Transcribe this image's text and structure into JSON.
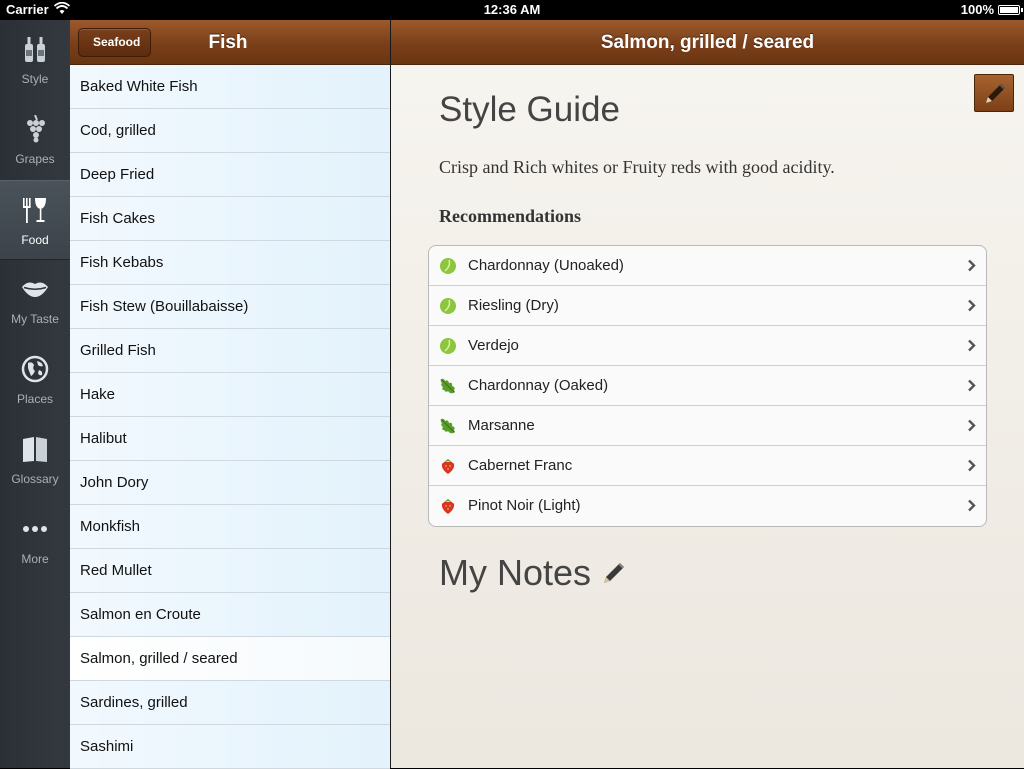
{
  "status": {
    "carrier": "Carrier",
    "time": "12:36 AM",
    "battery": "100%"
  },
  "rail": {
    "items": [
      {
        "label": "Style",
        "icon": "bottles-icon"
      },
      {
        "label": "Grapes",
        "icon": "grapes-icon"
      },
      {
        "label": "Food",
        "icon": "fork-glass-icon",
        "active": true
      },
      {
        "label": "My Taste",
        "icon": "lips-icon"
      },
      {
        "label": "Places",
        "icon": "globe-icon"
      },
      {
        "label": "Glossary",
        "icon": "book-icon"
      },
      {
        "label": "More",
        "icon": "ellipsis-icon"
      }
    ]
  },
  "master": {
    "back_label": "Seafood",
    "title": "Fish",
    "items": [
      "Baked White Fish",
      "Cod, grilled",
      "Deep Fried",
      "Fish Cakes",
      "Fish Kebabs",
      "Fish Stew (Bouillabaisse)",
      "Grilled Fish",
      "Hake",
      "Halibut",
      "John Dory",
      "Monkfish",
      "Red Mullet",
      "Salmon en Croute",
      "Salmon, grilled / seared",
      "Sardines, grilled",
      "Sashimi"
    ],
    "selected": "Salmon, grilled / seared"
  },
  "detail": {
    "title": "Salmon, grilled / seared",
    "heading": "Style Guide",
    "description": "Crisp and Rich whites or Fruity reds with good acidity.",
    "recommendations_title": "Recommendations",
    "recommendations": [
      {
        "label": "Chardonnay (Unoaked)",
        "icon": "green-grape-icon",
        "color": "#8cc63f"
      },
      {
        "label": "Riesling (Dry)",
        "icon": "green-grape-icon",
        "color": "#8cc63f"
      },
      {
        "label": "Verdejo",
        "icon": "green-grape-icon",
        "color": "#8cc63f"
      },
      {
        "label": "Chardonnay (Oaked)",
        "icon": "oak-leaf-icon",
        "color": "#5a9e2a"
      },
      {
        "label": "Marsanne",
        "icon": "oak-leaf-icon",
        "color": "#5a9e2a"
      },
      {
        "label": "Cabernet Franc",
        "icon": "strawberry-icon",
        "color": "#d9361e"
      },
      {
        "label": "Pinot Noir (Light)",
        "icon": "strawberry-icon",
        "color": "#d9361e"
      }
    ],
    "notes_heading": "My Notes"
  }
}
